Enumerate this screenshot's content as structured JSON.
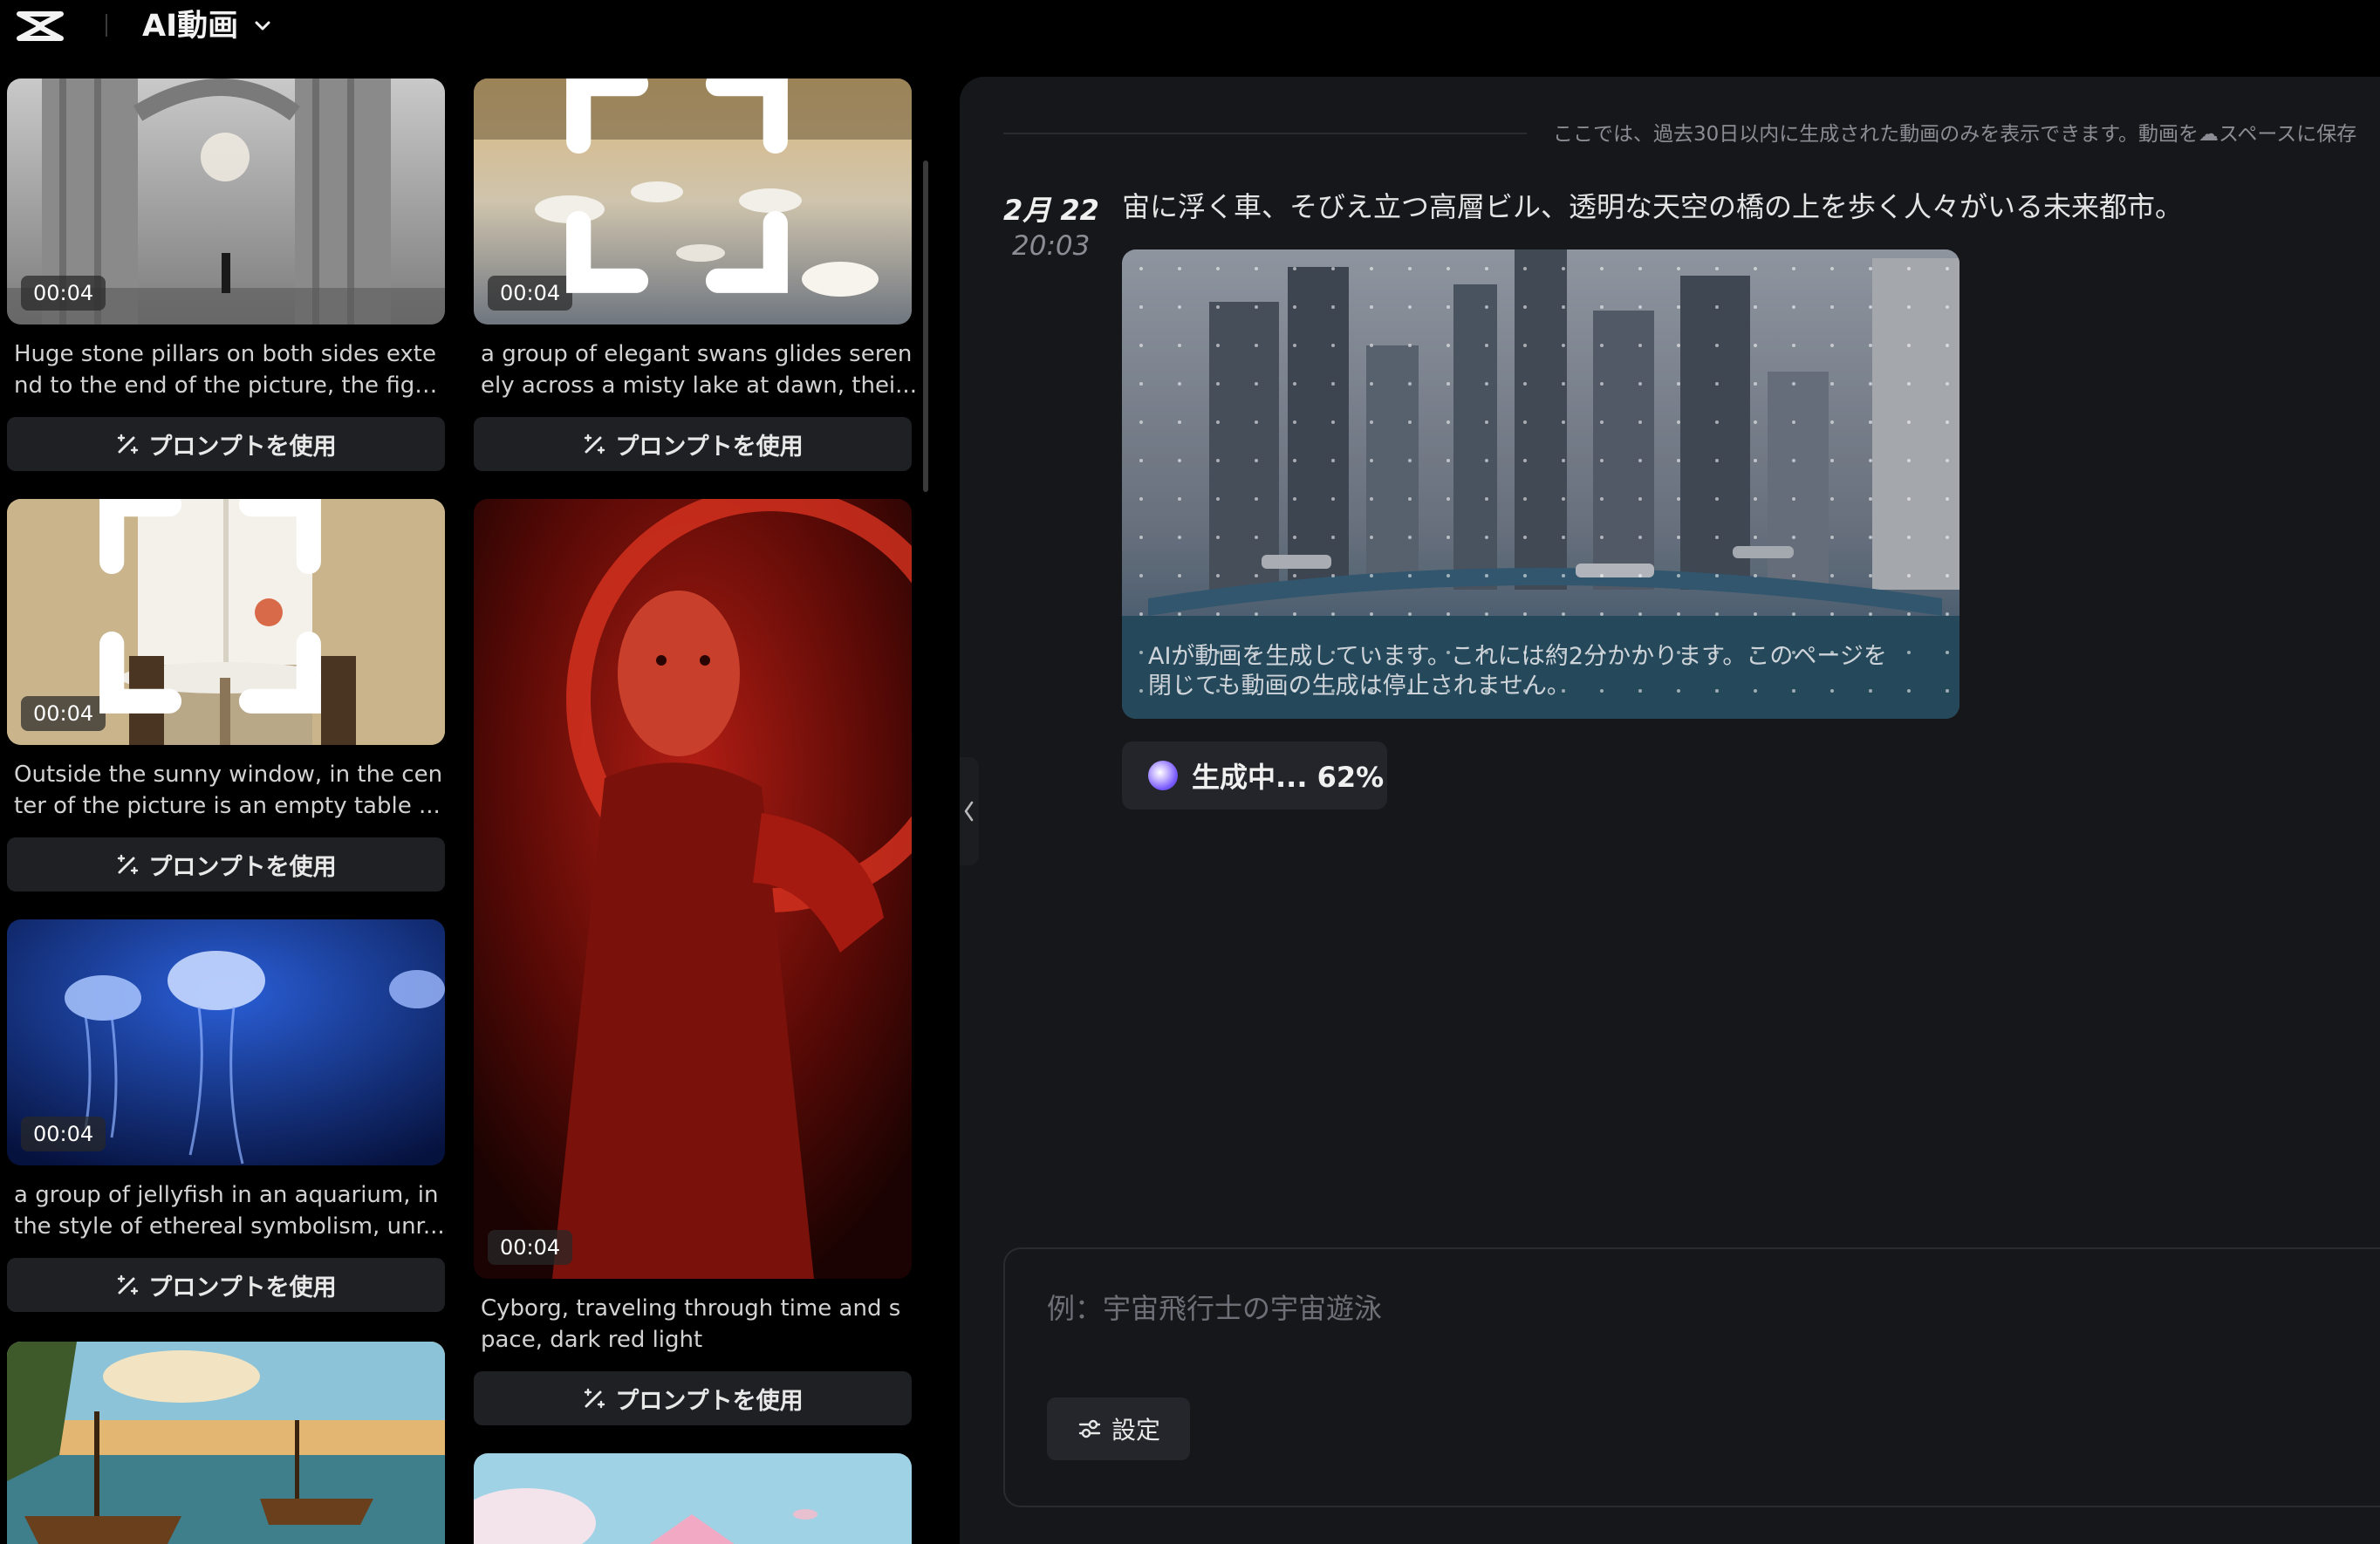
{
  "header": {
    "app_title": "AI動画",
    "logo_icon": "capcut-logo-icon",
    "dropdown_icon": "chevron-down-icon"
  },
  "gallery": {
    "use_prompt_label": "プロンプトを使用",
    "cards": [
      {
        "duration": "00:04",
        "desc_line1": "Huge stone pillars on both sides exte",
        "desc_line2": "nd to the end of the picture, the figu...",
        "scene": "stone-pillars"
      },
      {
        "duration": "00:04",
        "desc_line1": "a group of elegant swans glides seren",
        "desc_line2": "ely across a misty lake at dawn, thei...",
        "scene": "swans"
      },
      {
        "duration": "00:04",
        "desc_line1": "Outside the sunny window, in the cen",
        "desc_line2": "ter of the picture is an empty table ...",
        "scene": "window-table"
      },
      {
        "duration": "00:04",
        "desc_line1": "Cyborg, traveling through time and s",
        "desc_line2": "pace, dark red light",
        "scene": "cyborg"
      },
      {
        "duration": "00:04",
        "desc_line1": "a group of jellyfish in an aquarium, in",
        "desc_line2": "the style of ethereal symbolism, unr...",
        "scene": "jellyfish"
      },
      {
        "scene": "pirate-ships"
      },
      {
        "scene": "pink-building"
      }
    ]
  },
  "panel": {
    "notice": "ここでは、過去30日以内に生成された動画のみを表示できます。動画を☁スペースに保存",
    "message": {
      "date": "2月 22",
      "time": "20:03",
      "prompt": "宙に浮く車、そびえ立つ高層ビル、透明な天空の橋の上を歩く人々がいる未来都市。",
      "generating_line1": "AIが動画を生成しています。これには約2分かかります。このページを",
      "generating_line2": "閉じても動画の生成は停止されません。",
      "status": "生成中... 62%",
      "progress_percent": 62
    },
    "input": {
      "placeholder": "例：宇宙飛行士の宇宙遊泳",
      "value": ""
    },
    "settings_label": "設定"
  },
  "colors": {
    "background": "#000000",
    "panel": "#16171b",
    "button": "#1f2024",
    "accent_orb": "#7a5cff"
  }
}
